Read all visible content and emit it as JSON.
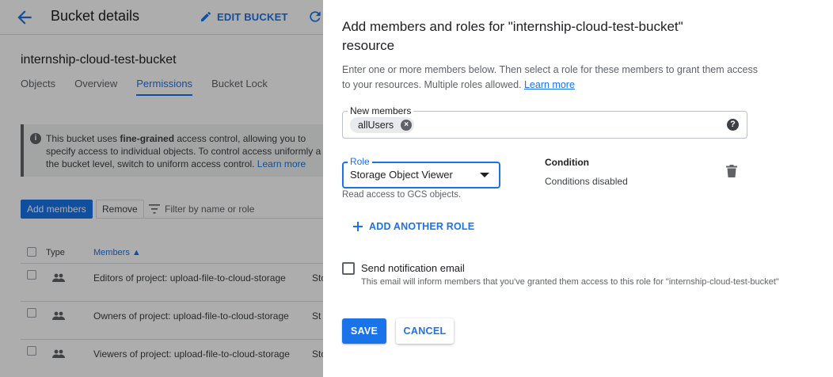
{
  "background": {
    "header": {
      "title": "Bucket details",
      "edit_label": "EDIT BUCKET"
    },
    "bucket_name": "internship-cloud-test-bucket",
    "tabs": [
      {
        "label": "Objects"
      },
      {
        "label": "Overview"
      },
      {
        "label": "Permissions",
        "active": true
      },
      {
        "label": "Bucket Lock"
      }
    ],
    "info": {
      "line1_prefix": "This bucket uses ",
      "line1_bold": "fine-grained",
      "line1_suffix": " access control, allowing you to",
      "line2": "specify access to individual objects. To control access uniformly a",
      "line3": "the bucket level, switch to uniform access control. ",
      "link": "Learn more"
    },
    "toolbar": {
      "add_members": "Add members",
      "remove": "Remove",
      "filter_placeholder": "Filter by name or role"
    },
    "table": {
      "col_type": "Type",
      "col_members": "Members",
      "rows": [
        {
          "name": "Editors of project: upload-file-to-cloud-storage",
          "role": "Sto"
        },
        {
          "name": "Owners of project: upload-file-to-cloud-storage",
          "role": "St"
        },
        {
          "name": "Viewers of project: upload-file-to-cloud-storage",
          "role": "Sto"
        }
      ]
    }
  },
  "panel": {
    "title": "Add members and roles for \"internship-cloud-test-bucket\" resource",
    "description": "Enter one or more members below. Then select a role for these members to grant them access to your resources. Multiple roles allowed. ",
    "learn_more": "Learn more",
    "new_members_label": "New members",
    "member_chip": "allUsers",
    "help_icon": "?",
    "role_label": "Role",
    "role_value": "Storage Object Viewer",
    "role_hint": "Read access to GCS objects.",
    "condition_title": "Condition",
    "condition_value": "Conditions disabled",
    "add_role_label": "ADD ANOTHER ROLE",
    "notify_label": "Send notification email",
    "notify_hint": "This email will inform members that you've granted them access to this role for \"internship-cloud-test-bucket\"",
    "save_label": "SAVE",
    "cancel_label": "CANCEL"
  },
  "colors": {
    "accent": "#1a73e8",
    "scrim": "rgba(0,0,0,0.32)"
  }
}
